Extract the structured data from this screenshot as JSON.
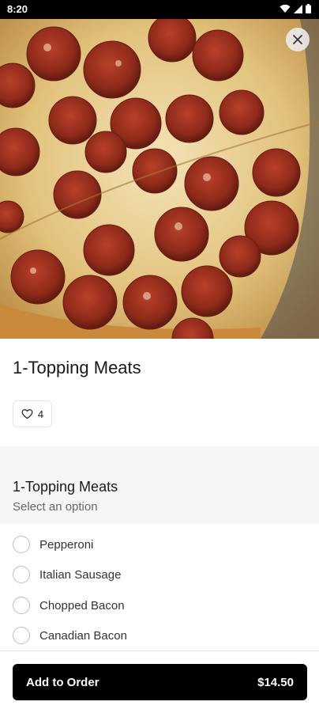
{
  "status_bar": {
    "time": "8:20",
    "icons": [
      "wifi-icon",
      "cell-signal-icon",
      "battery-icon"
    ]
  },
  "hero": {
    "alt": "pizza-photo"
  },
  "item": {
    "title": "1-Topping Meats",
    "likes": "4"
  },
  "section": {
    "title": "1-Topping Meats",
    "subtitle": "Select an option",
    "options": [
      "Pepperoni",
      "Italian Sausage",
      "Chopped Bacon",
      "Canadian Bacon"
    ]
  },
  "footer": {
    "button_label": "Add to Order",
    "price": "$14.50"
  }
}
